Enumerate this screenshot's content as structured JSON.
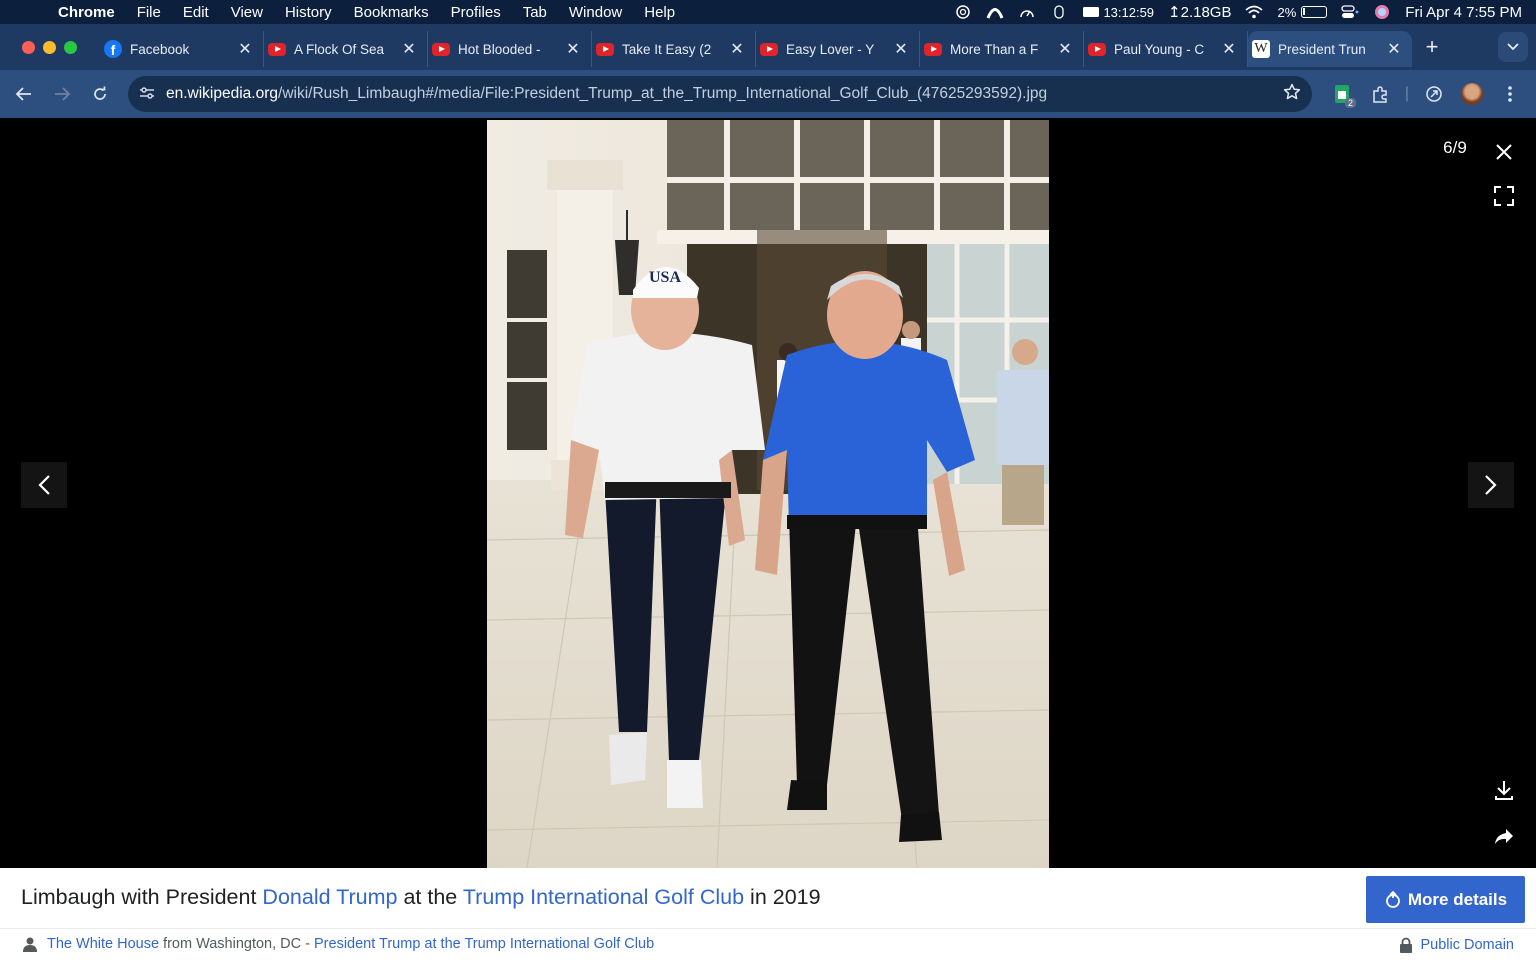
{
  "menubar": {
    "app": "Chrome",
    "items": [
      "File",
      "Edit",
      "View",
      "History",
      "Bookmarks",
      "Profiles",
      "Tab",
      "Window",
      "Help"
    ],
    "clock_small": "13:12:59",
    "memory": "↥2.18GB",
    "battery": "2%",
    "datetime": "Fri Apr 4  7:55 PM"
  },
  "tabs": [
    {
      "title": "Facebook",
      "icon": "facebook-icon"
    },
    {
      "title": "A Flock Of Sea",
      "icon": "youtube-icon"
    },
    {
      "title": "Hot Blooded -",
      "icon": "youtube-icon"
    },
    {
      "title": "Take It Easy (2",
      "icon": "youtube-icon"
    },
    {
      "title": "Easy Lover - Y",
      "icon": "youtube-icon"
    },
    {
      "title": "More Than a F",
      "icon": "youtube-icon"
    },
    {
      "title": "Paul Young - C",
      "icon": "youtube-icon"
    },
    {
      "title": "President Trun",
      "icon": "wikipedia-icon",
      "active": true
    }
  ],
  "toolbar": {
    "url_domain": "en.wikipedia.org",
    "url_path": "/wiki/Rush_Limbaugh#/media/File:President_Trump_at_the_Trump_International_Golf_Club_(47625293592).jpg",
    "ext_badge": "2"
  },
  "viewer": {
    "counter": "6/9",
    "hat_text": "USA"
  },
  "caption": {
    "prefix": "Limbaugh with President ",
    "link1": "Donald Trump",
    "middle": " at the ",
    "link2": "Trump International Golf Club",
    "suffix": " in 2019",
    "more_details": "More details"
  },
  "credit": {
    "author": "The White House",
    "from": " from Washington, DC - ",
    "source": "President Trump at the Trump International Golf Club",
    "license": "Public Domain"
  }
}
